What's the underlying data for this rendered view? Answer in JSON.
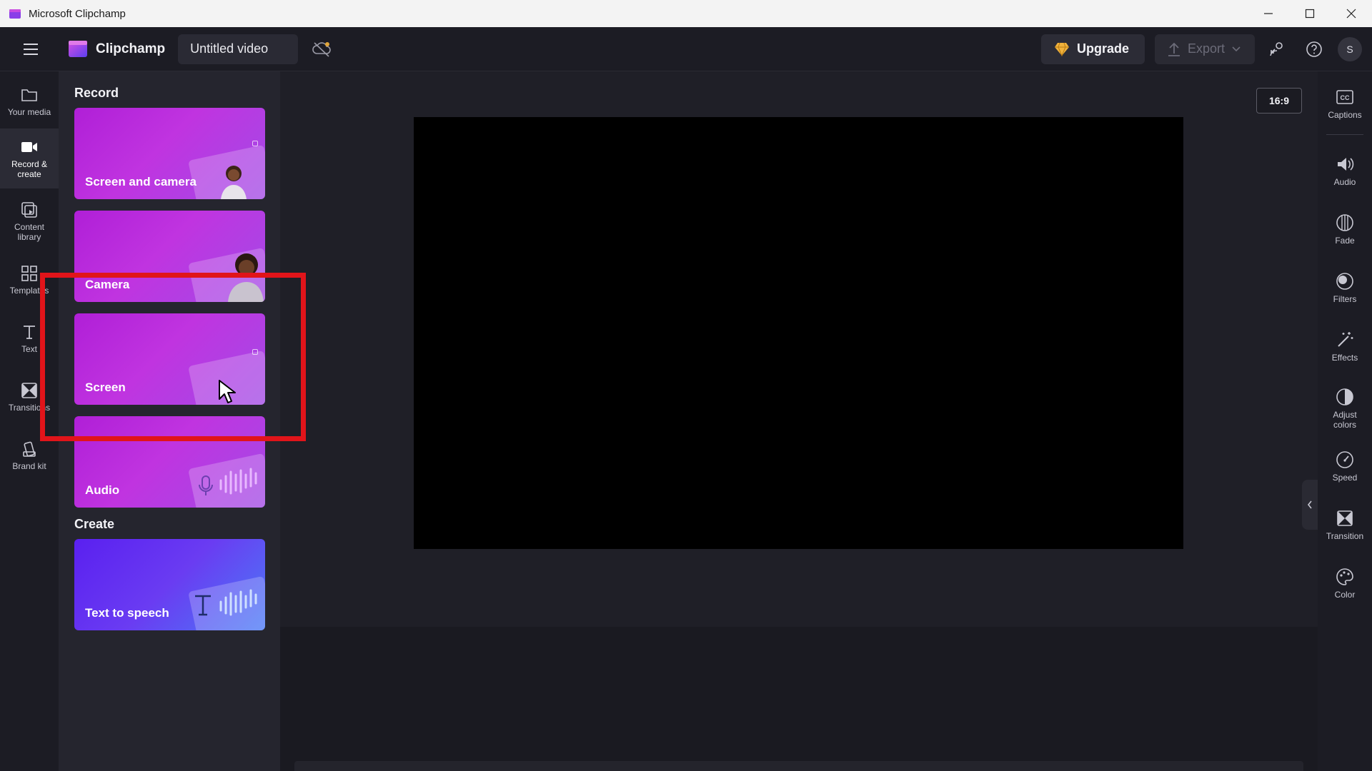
{
  "window": {
    "title": "Microsoft Clipchamp"
  },
  "topbar": {
    "brand": "Clipchamp",
    "video_title": "Untitled video",
    "upgrade_label": "Upgrade",
    "export_label": "Export",
    "avatar_initial": "S"
  },
  "leftnav": {
    "items": [
      {
        "label": "Your media",
        "icon": "folder-icon"
      },
      {
        "label": "Record & create",
        "icon": "video-camera-icon"
      },
      {
        "label": "Content library",
        "icon": "library-icon"
      },
      {
        "label": "Templates",
        "icon": "templates-icon"
      },
      {
        "label": "Text",
        "icon": "text-icon"
      },
      {
        "label": "Transitions",
        "icon": "transitions-icon"
      },
      {
        "label": "Brand kit",
        "icon": "brand-kit-icon"
      }
    ],
    "active": "Record & create"
  },
  "panel": {
    "record_heading": "Record",
    "create_heading": "Create",
    "record_cards": [
      {
        "label": "Screen and camera"
      },
      {
        "label": "Camera"
      },
      {
        "label": "Screen"
      },
      {
        "label": "Audio"
      }
    ],
    "create_cards": [
      {
        "label": "Text to speech"
      }
    ]
  },
  "stage": {
    "aspect_ratio": "16:9"
  },
  "rightnav": {
    "items": [
      {
        "label": "Captions",
        "icon": "captions-icon"
      },
      {
        "label": "Audio",
        "icon": "speaker-icon"
      },
      {
        "label": "Fade",
        "icon": "fade-icon"
      },
      {
        "label": "Filters",
        "icon": "filters-icon"
      },
      {
        "label": "Effects",
        "icon": "magic-wand-icon"
      },
      {
        "label": "Adjust colors",
        "icon": "contrast-icon"
      },
      {
        "label": "Speed",
        "icon": "speedometer-icon"
      },
      {
        "label": "Transition",
        "icon": "transition-icon"
      },
      {
        "label": "Color",
        "icon": "palette-icon"
      }
    ]
  },
  "colors": {
    "accent_purple": "#b01fd7",
    "accent_blue": "#5a20f0",
    "highlight_red": "#e1141a",
    "background": "#1f1f27"
  }
}
